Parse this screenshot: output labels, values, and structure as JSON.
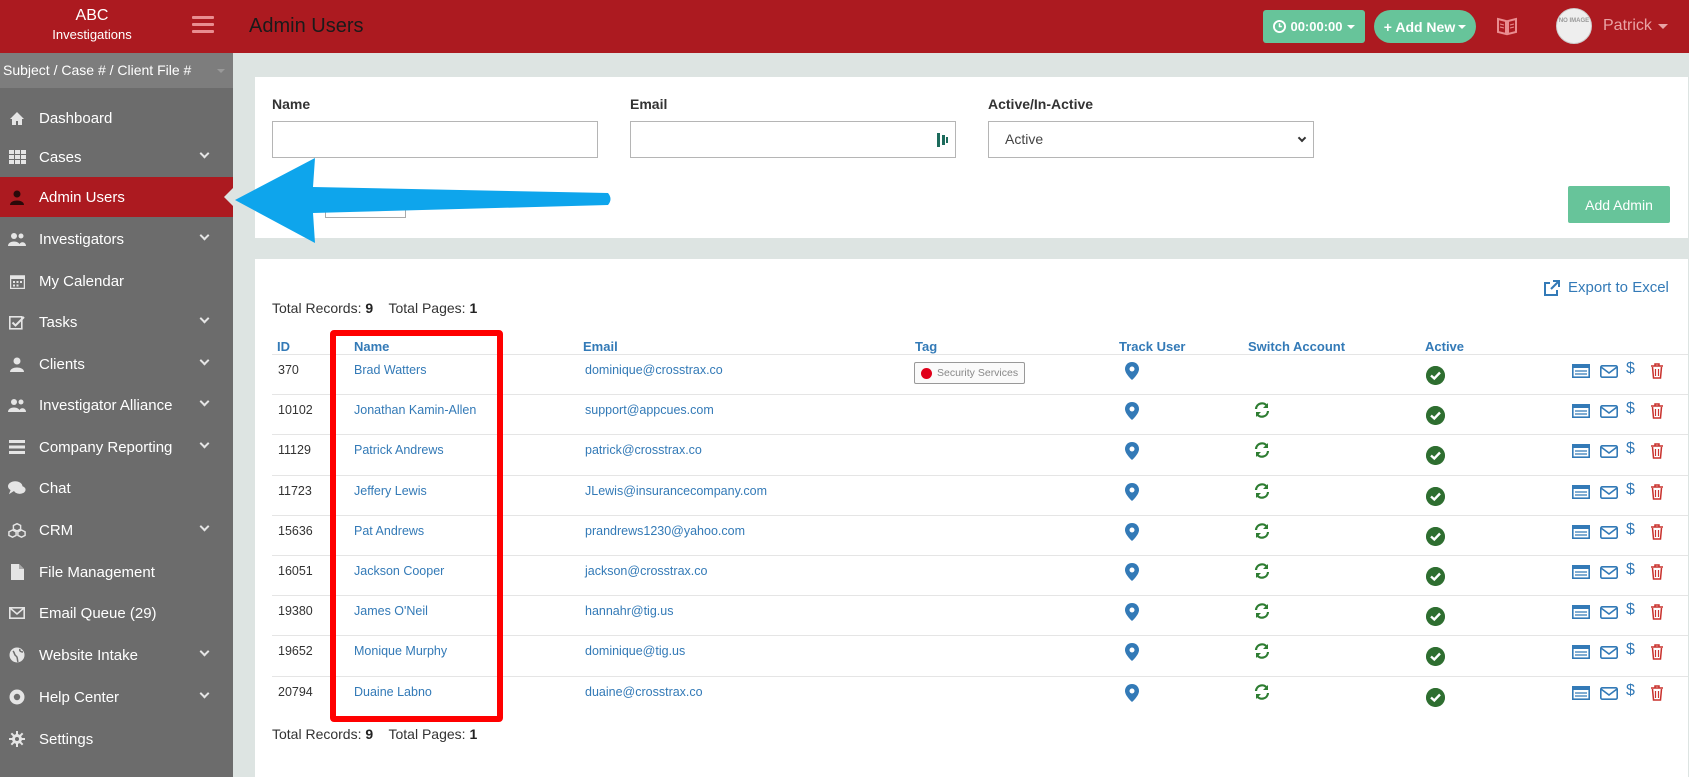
{
  "brand": {
    "line1": "ABC",
    "line2": "Investigations"
  },
  "header": {
    "title": "Admin Users",
    "timer_label": "00:00:00",
    "add_new_label": "+ Add New",
    "user_name": "Patrick",
    "avatar_text": "NO IMAGE"
  },
  "sidebar": {
    "search_placeholder": "Subject / Case # / Client File #",
    "items": [
      {
        "label": "Dashboard",
        "icon": "home-icon",
        "chevron": false
      },
      {
        "label": "Cases",
        "icon": "grid-icon",
        "chevron": true
      },
      {
        "label": "Admin Users",
        "icon": "user-icon",
        "chevron": false,
        "active": true
      },
      {
        "label": "Investigators",
        "icon": "users-icon",
        "chevron": true
      },
      {
        "label": "My Calendar",
        "icon": "calendar-icon",
        "chevron": false
      },
      {
        "label": "Tasks",
        "icon": "check-square-icon",
        "chevron": true
      },
      {
        "label": "Clients",
        "icon": "user-icon",
        "chevron": true
      },
      {
        "label": "Investigator Alliance",
        "icon": "users-icon",
        "chevron": true
      },
      {
        "label": "Company Reporting",
        "icon": "list-icon",
        "chevron": true
      },
      {
        "label": "Chat",
        "icon": "chat-icon",
        "chevron": false
      },
      {
        "label": "CRM",
        "icon": "cubes-icon",
        "chevron": true
      },
      {
        "label": "File Management",
        "icon": "file-icon",
        "chevron": false
      },
      {
        "label": "Email Queue (29)",
        "icon": "envelope-icon",
        "chevron": false
      },
      {
        "label": "Website Intake",
        "icon": "globe-icon",
        "chevron": true
      },
      {
        "label": "Help Center",
        "icon": "help-icon",
        "chevron": true
      },
      {
        "label": "Settings",
        "icon": "gear-icon",
        "chevron": false
      }
    ]
  },
  "filters": {
    "name_label": "Name",
    "name_value": "",
    "email_label": "Email",
    "email_value": "",
    "active_label": "Active/In-Active",
    "active_value": "Active",
    "add_admin_label": "Add Admin"
  },
  "table": {
    "export_label": "Export to Excel",
    "total_records_label": "Total Records:",
    "total_records": "9",
    "total_pages_label": "Total Pages:",
    "total_pages": "1",
    "headers": [
      "ID",
      "Name",
      "Email",
      "Tag",
      "Track User",
      "Switch Account",
      "Active"
    ],
    "rows": [
      {
        "id": "370",
        "name": "Brad Watters",
        "email": "dominique@crosstrax.co",
        "tag": "Security Services",
        "switch": false
      },
      {
        "id": "10102",
        "name": "Jonathan Kamin-Allen",
        "email": "support@appcues.com",
        "tag": "",
        "switch": true
      },
      {
        "id": "11129",
        "name": "Patrick Andrews",
        "email": "patrick@crosstrax.co",
        "tag": "",
        "switch": true
      },
      {
        "id": "11723",
        "name": "Jeffery Lewis",
        "email": "JLewis@insurancecompany.com",
        "tag": "",
        "switch": true
      },
      {
        "id": "15636",
        "name": "Pat Andrews",
        "email": "prandrews1230@yahoo.com",
        "tag": "",
        "switch": true
      },
      {
        "id": "16051",
        "name": "Jackson Cooper",
        "email": "jackson@crosstrax.co",
        "tag": "",
        "switch": true
      },
      {
        "id": "19380",
        "name": "James O'Neil",
        "email": "hannahr@tig.us",
        "tag": "",
        "switch": true
      },
      {
        "id": "19652",
        "name": "Monique Murphy",
        "email": "dominique@tig.us",
        "tag": "",
        "switch": true
      },
      {
        "id": "20794",
        "name": "Duaine Labno",
        "email": "duaine@crosstrax.co",
        "tag": "",
        "switch": true
      }
    ],
    "action_dollar": "$"
  },
  "colors": {
    "brand_red": "#ac1a20",
    "accent_green": "#67c49a",
    "link_blue": "#337ab7",
    "active_green": "#2e6e30",
    "sidebar_gray": "#6c6c6c",
    "annotation_red": "#ff0000",
    "annotation_blue": "#0ea5ec"
  }
}
